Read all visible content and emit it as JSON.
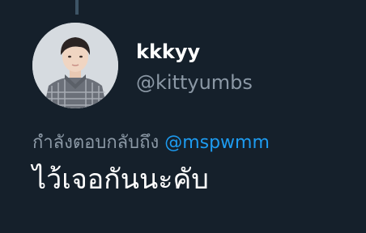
{
  "tweet": {
    "display_name": "kkkyy",
    "username": "@kittyumbs",
    "reply_prefix": "กำลังตอบกลับถึง",
    "reply_mention": "@mspwmm",
    "text": "ไว้เจอกันนะคับ"
  },
  "colors": {
    "background": "#15202b",
    "name": "#ffffff",
    "muted": "#8b98a5",
    "mention": "#1d9bf0",
    "thread_line": "#3d5466"
  },
  "icons": {
    "avatar": "profile-photo"
  }
}
